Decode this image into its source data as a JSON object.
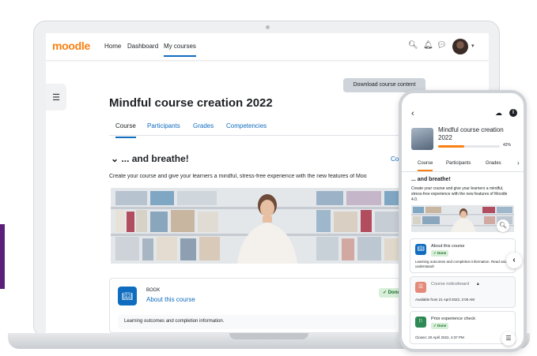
{
  "navbar": {
    "logo": "moodle",
    "links": [
      {
        "label": "Home"
      },
      {
        "label": "Dashboard"
      },
      {
        "label": "My courses"
      }
    ],
    "icons": [
      "search-icon",
      "bell-icon",
      "chat-icon",
      "avatar",
      "chevron-down-icon"
    ]
  },
  "course": {
    "download_label": "Download course content",
    "title": "Mindful course creation 2022",
    "tabs": [
      "Course",
      "Participants",
      "Grades",
      "Competencies"
    ],
    "section_title": "... and breathe!",
    "collapse_label": "Co",
    "section_desc": "Create your course and give your learners a mindful, stress-free experience with the new features of Moo"
  },
  "activity": {
    "type": "BOOK",
    "name": "About this course",
    "status": "✓ Done",
    "description": "Learning outcomes and completion information."
  },
  "phone": {
    "course_title": "Mindful course creation 2022",
    "progress_percent": 42,
    "progress_label": "42%",
    "tabs": [
      "Course",
      "Participants",
      "Grades"
    ],
    "section_title": "... and breathe!",
    "section_desc": "Create your course and give your learners a mindful, stress-free experience with the new features of Moodle 4.0.",
    "cards": [
      {
        "name": "About this course",
        "status": "✓ Done",
        "desc": "Learning outcomes and completion information. Read and understand!"
      },
      {
        "name": "Course noticeboard",
        "meta": "Available from 21 April 2022, 2:00 AM"
      },
      {
        "name": "Prior experience check",
        "status": "✓ Done",
        "meta": "Closes: 20 April 2022, 4:37 PM"
      }
    ]
  },
  "colors": {
    "brand_orange": "#f98012",
    "link_blue": "#0f6cbf",
    "done_green": "#1c6f2a",
    "accent_purple": "#5b1f7a"
  }
}
